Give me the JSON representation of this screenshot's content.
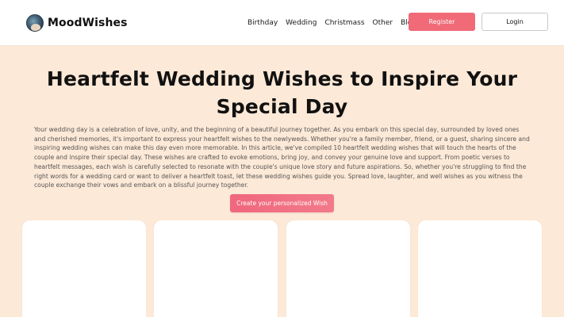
{
  "brand": {
    "name": "MoodWishes",
    "logo_icon": "moodwishes-logo-icon"
  },
  "nav": {
    "links": [
      "Birthday",
      "Wedding",
      "Christmass",
      "Other",
      "Blog"
    ],
    "register_label": "Register",
    "login_label": "Login"
  },
  "hero": {
    "title": "Heartfelt Wedding Wishes to Inspire Your Special Day",
    "intro": "Your wedding day is a celebration of love, unity, and the beginning of a beautiful journey together. As you embark on this special day, surrounded by loved ones and cherished memories, it's important to express your heartfelt wishes to the newlyweds. Whether you're a family member, friend, or a guest, sharing sincere and inspiring wedding wishes can make this day even more memorable. In this article, we've compiled 10 heartfelt wedding wishes that will touch the hearts of the couple and inspire their special day. These wishes are crafted to evoke emotions, bring joy, and convey your genuine love and support. From poetic verses to heartfelt messages, each wish is carefully selected to resonate with the couple's unique love story and future aspirations. So, whether you're struggling to find the right words for a wedding card or want to deliver a heartfelt toast, let these wedding wishes guide you. Spread love, laughter, and well wishes as you witness the couple exchange their vows and embark on a blissful journey together.",
    "cta_label": "Create your personalized Wish"
  },
  "colors": {
    "page_background": "#fde9d7",
    "accent": "#f06a78",
    "card_background": "#ffffff"
  }
}
